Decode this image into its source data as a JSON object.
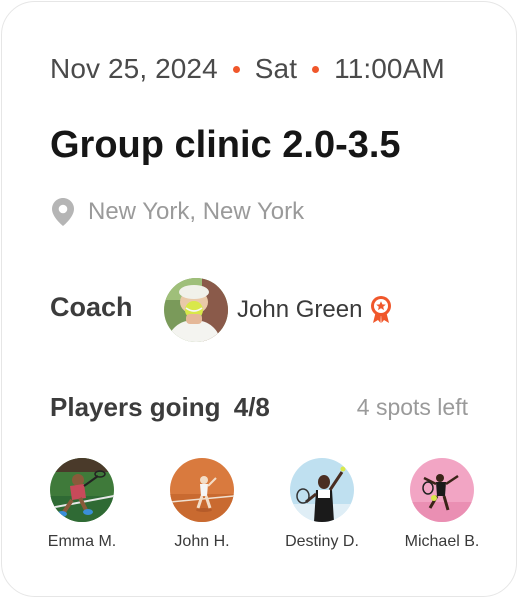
{
  "event": {
    "date": "Nov 25, 2024",
    "day": "Sat",
    "time": "11:00AM",
    "title": "Group clinic 2.0-3.5",
    "location": "New York, New York"
  },
  "coach": {
    "label": "Coach",
    "name": "John Green",
    "badge_icon": "award-ribbon-icon"
  },
  "players": {
    "label": "Players going",
    "count": "4/8",
    "spots_left": "4 spots left",
    "list": [
      {
        "name": "Emma M."
      },
      {
        "name": "John H."
      },
      {
        "name": "Destiny D."
      },
      {
        "name": "Michael B."
      }
    ]
  },
  "colors": {
    "accent": "#f0572b",
    "text_primary": "#161616",
    "text_muted": "#9a9a9a",
    "location_icon": "#b5b5b5"
  }
}
